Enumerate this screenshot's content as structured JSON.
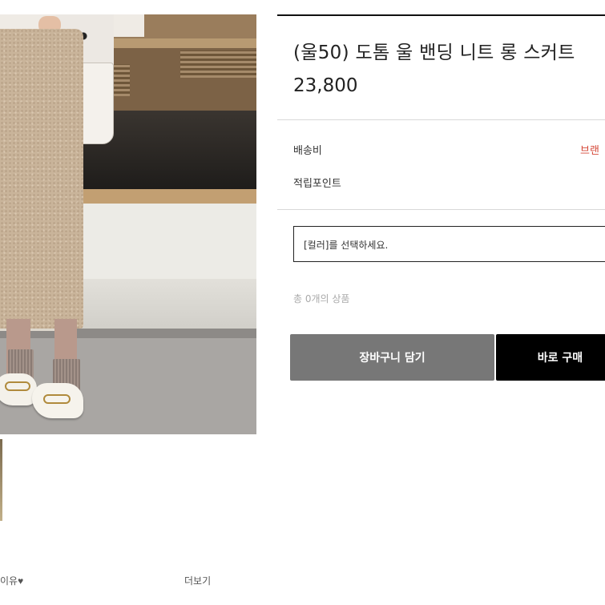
{
  "product": {
    "title": "(울50) 도톰 울 밴딩 니트 롱 스커트",
    "price": "23,800"
  },
  "info": {
    "shipping_label": "배송비",
    "shipping_value": "브랜",
    "points_label": "적립포인트"
  },
  "option": {
    "placeholder": "[컬러]를 선택하세요."
  },
  "summary": {
    "total_text": "총 0개의 상품"
  },
  "actions": {
    "cart_label": "장바구니 담기",
    "buy_label": "바로 구매"
  },
  "bottom": {
    "left_text": "이유♥",
    "more_label": "더보기"
  },
  "colors": {
    "brand_red": "#d64a3a",
    "cart_button": "#777777",
    "buy_button": "#000000"
  }
}
